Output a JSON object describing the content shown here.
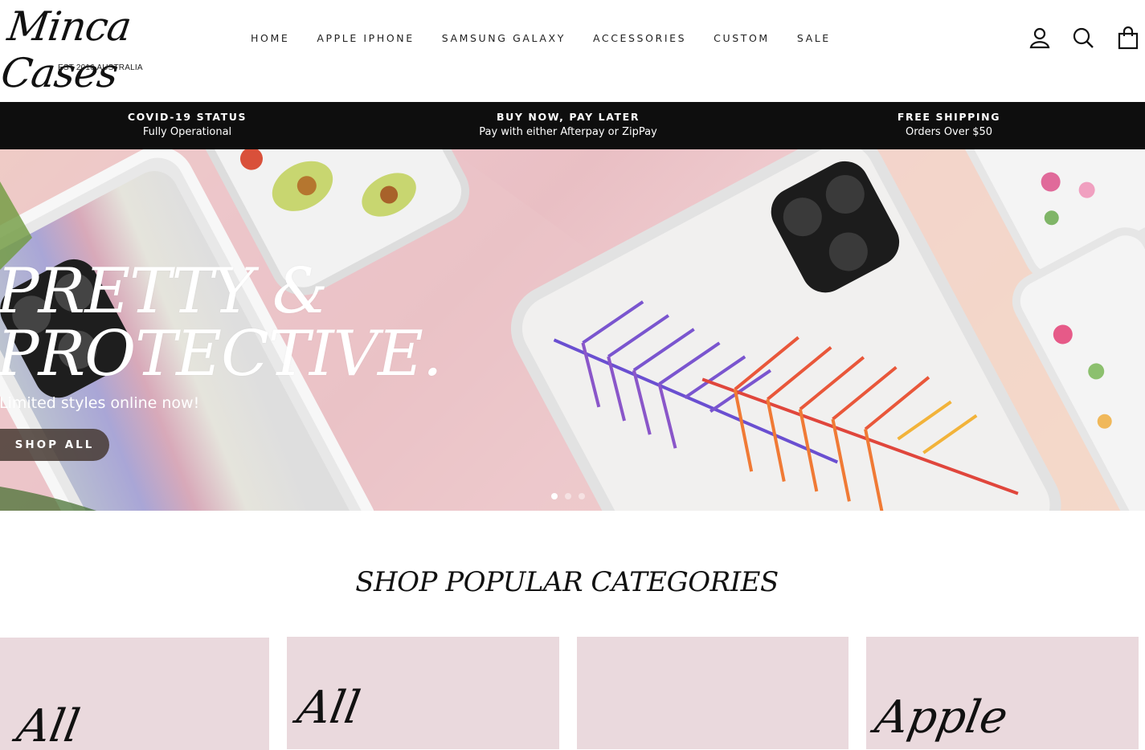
{
  "header": {
    "logo_text": "Minca Cases",
    "logo_subtitle": "EST 2016 AUSTRALIA",
    "nav": [
      "HOME",
      "APPLE IPHONE",
      "SAMSUNG GALAXY",
      "ACCESSORIES",
      "CUSTOM",
      "SALE"
    ],
    "icons": [
      "account-icon",
      "search-icon",
      "cart-icon"
    ]
  },
  "promo": [
    {
      "title": "COVID-19 STATUS",
      "subtitle": "Fully Operational"
    },
    {
      "title": "BUY NOW, PAY LATER",
      "subtitle": "Pay with either Afterpay or ZipPay"
    },
    {
      "title": "FREE SHIPPING",
      "subtitle": "Orders Over $50"
    }
  ],
  "hero": {
    "title_line1": "PRETTY &",
    "title_line2": "PROTECTIVE.",
    "subtitle": "Limited styles online now!",
    "button": "SHOP ALL",
    "slides": 3,
    "active_slide": 1
  },
  "categories": {
    "title": "SHOP POPULAR CATEGORIES",
    "cards": [
      {
        "label": "All"
      },
      {
        "label": "All"
      },
      {
        "label": ""
      },
      {
        "label": "Apple"
      }
    ]
  },
  "colors": {
    "promo_bg": "#0e0e0e",
    "card_bg": "#ead9dd",
    "button_bg": "#463a32"
  }
}
